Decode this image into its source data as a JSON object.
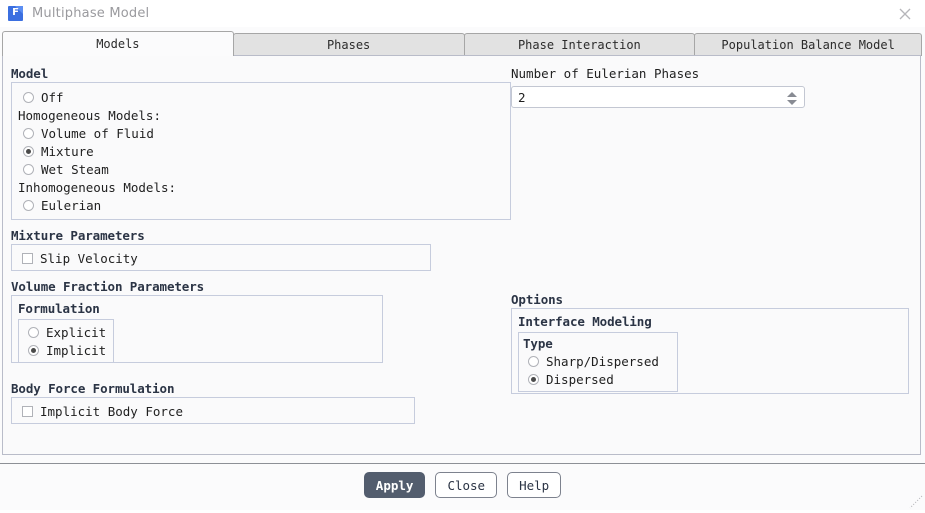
{
  "window": {
    "title": "Multiphase Model",
    "app_icon": "fluent-f-icon",
    "close_icon": "close-icon",
    "resize_grip": "resize-grip-icon"
  },
  "tabs": [
    {
      "label": "Models",
      "active": true
    },
    {
      "label": "Phases",
      "active": false
    },
    {
      "label": "Phase Interaction",
      "active": false
    },
    {
      "label": "Population Balance Model",
      "active": false
    }
  ],
  "model_group": {
    "title": "Model",
    "off": "Off",
    "homogeneous_header": "Homogeneous Models:",
    "volume_of_fluid": "Volume of Fluid",
    "mixture": "Mixture",
    "wet_steam": "Wet Steam",
    "inhomogeneous_header": "Inhomogeneous Models:",
    "eulerian": "Eulerian"
  },
  "eulerian_phases": {
    "label": "Number of Eulerian Phases",
    "value": "2",
    "up_icon": "arrow-up-icon",
    "down_icon": "arrow-down-icon"
  },
  "mixture_parameters": {
    "title": "Mixture Parameters",
    "slip_velocity": "Slip Velocity"
  },
  "volume_fraction_parameters": {
    "title": "Volume Fraction Parameters",
    "formulation_title": "Formulation",
    "explicit": "Explicit",
    "implicit": "Implicit"
  },
  "options": {
    "title": "Options",
    "interface_modeling_title": "Interface Modeling",
    "type_title": "Type",
    "sharp_dispersed": "Sharp/Dispersed",
    "dispersed": "Dispersed"
  },
  "body_force_formulation": {
    "title": "Body Force Formulation",
    "implicit_body_force": "Implicit Body Force"
  },
  "footer": {
    "apply": "Apply",
    "close": "Close",
    "help": "Help"
  },
  "colors": {
    "accent": "#3b6fe0",
    "primary_button": "#535d6e",
    "group_border": "#c6ccdd",
    "panel_bg": "#fafafb"
  }
}
